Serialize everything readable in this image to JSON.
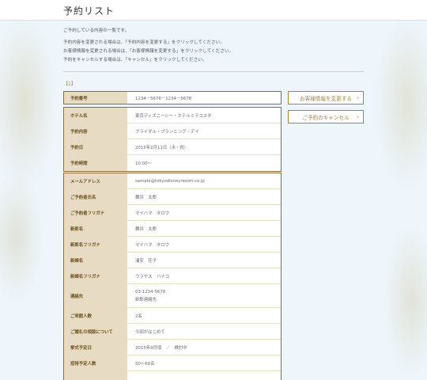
{
  "header": {
    "title": "予約リスト"
  },
  "intro": {
    "lines": [
      "ご予約している内容の一覧です。",
      "予約内容を変更される場合は、「予約内容を変更する」をクリックしてください。",
      "お客様情報を変更される場合は、「お客様情報を変更する」をクリックしてください。",
      "予約をキャンセルする場合は、「キャンセル」をクリックしてください。"
    ]
  },
  "section": {
    "label": "【1】"
  },
  "reservation_number": {
    "label": "予約番号",
    "value": "1234－5678－1234－5678"
  },
  "reservation_rows": [
    {
      "label": "ホテル名",
      "value": "東京ディズニーシー・ホテルミラコスタ"
    },
    {
      "label": "予約内容",
      "value": "ブライダル・プランニング・デイ"
    },
    {
      "label": "予約日",
      "value": "2015年2月11日（水・祝）"
    },
    {
      "label": "予約時間",
      "value": "10:00～"
    }
  ],
  "customer_rows": [
    {
      "label": "メールアドレス",
      "value": "sample@tokyodisneyresort.co.jp"
    },
    {
      "label": "ご予約者氏名",
      "value": "舞浜　太郎"
    },
    {
      "label": "ご予約者フリガナ",
      "value": "マイハマ　タロウ"
    },
    {
      "label": "新郎名",
      "value": "舞浜　太郎"
    },
    {
      "label": "新郎名フリガナ",
      "value": "マイハマ　タロウ"
    },
    {
      "label": "新婦名",
      "value": "浦安　花子"
    },
    {
      "label": "新婦名フリガナ",
      "value": "ウラヤス　ハナコ"
    },
    {
      "label": "連絡先",
      "value": "03-1234-5678",
      "sub": "新郎連絡先"
    },
    {
      "label": "ご来館人数",
      "value": "2名"
    },
    {
      "label": "ご婚礼の相談について",
      "value": "今回がはじめて"
    },
    {
      "label": "挙式予定日",
      "value": "2015年9月頃　／　検討中"
    },
    {
      "label": "招待予定人数",
      "value": "50～60名"
    },
    {
      "label": "",
      "value": ""
    }
  ],
  "actions": {
    "change_customer": "お客様情報を変更する",
    "cancel": "ご予約のキャンセル"
  },
  "colors": {
    "accent": "#a8823e",
    "label_bg": "#e7dcc3",
    "page_bg": "#eef6fc"
  }
}
